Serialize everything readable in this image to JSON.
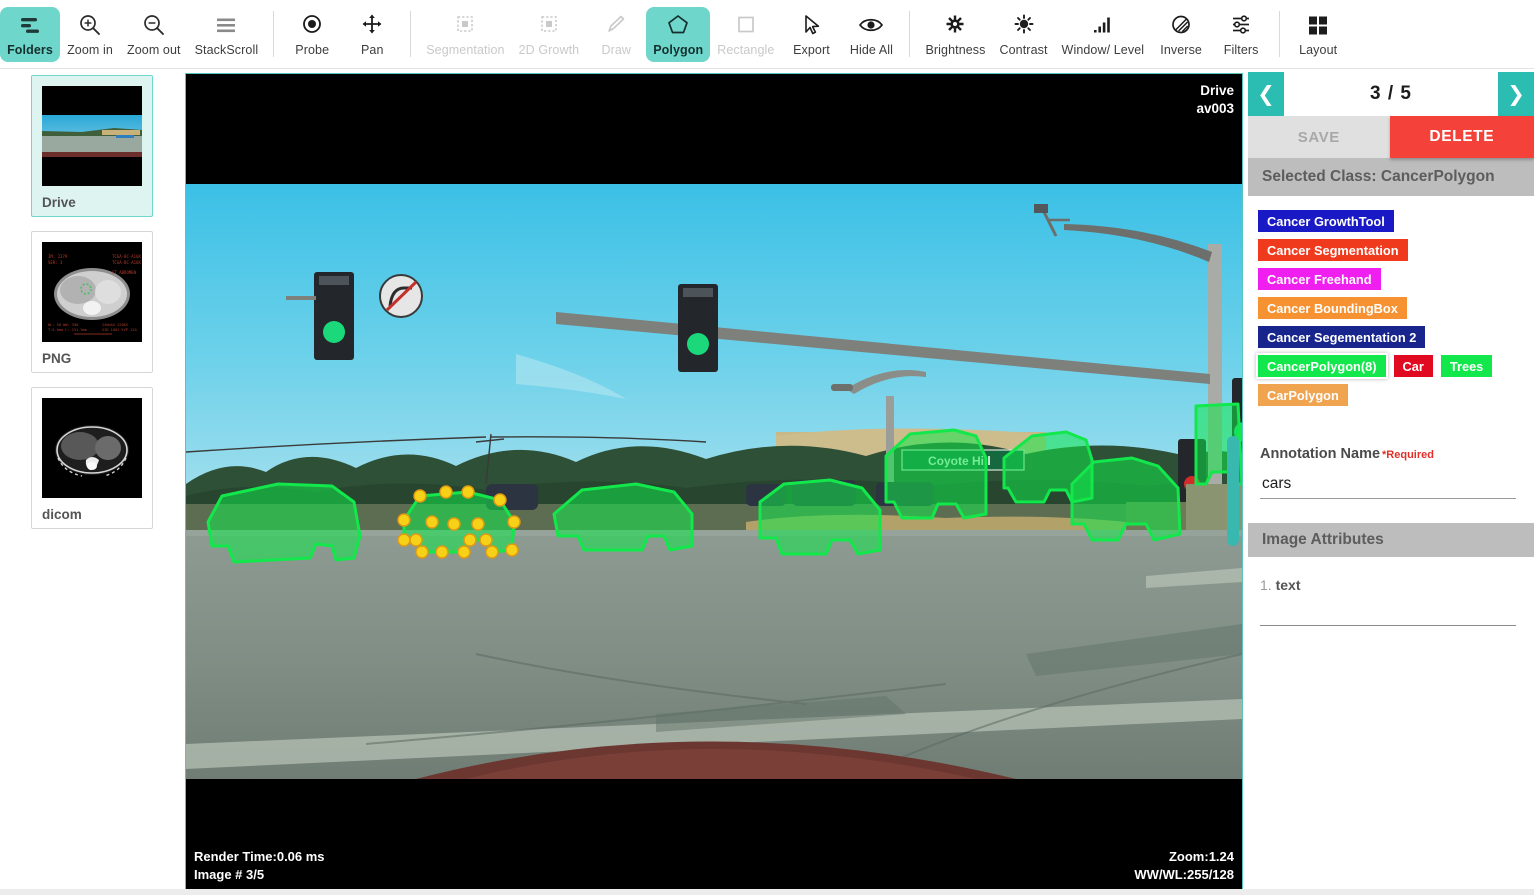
{
  "toolbar": {
    "groups": [
      {
        "tools": [
          {
            "label": "Folders",
            "icon": "folders-icon",
            "state": "active"
          },
          {
            "label": "Zoom in",
            "icon": "zoom-in-icon",
            "state": "normal"
          },
          {
            "label": "Zoom out",
            "icon": "zoom-out-icon",
            "state": "normal"
          },
          {
            "label": "StackScroll",
            "icon": "stack-scroll-icon",
            "state": "normal"
          }
        ]
      },
      {
        "tools": [
          {
            "label": "Probe",
            "icon": "probe-icon",
            "state": "normal"
          },
          {
            "label": "Pan",
            "icon": "pan-icon",
            "state": "normal"
          }
        ]
      },
      {
        "tools": [
          {
            "label": "Segmentation",
            "icon": "segmentation-icon",
            "state": "disabled"
          },
          {
            "label": "2D Growth",
            "icon": "growth-2d-icon",
            "state": "disabled"
          },
          {
            "label": "Draw",
            "icon": "draw-pencil-icon",
            "state": "disabled"
          },
          {
            "label": "Polygon",
            "icon": "polygon-icon",
            "state": "active"
          },
          {
            "label": "Rectangle",
            "icon": "rectangle-icon",
            "state": "disabled"
          },
          {
            "label": "Export",
            "icon": "cursor-arrow-icon",
            "state": "normal"
          },
          {
            "label": "Hide All",
            "icon": "eye-icon",
            "state": "normal"
          }
        ]
      },
      {
        "tools": [
          {
            "label": "Brightness",
            "icon": "brightness-icon",
            "state": "normal"
          },
          {
            "label": "Contrast",
            "icon": "contrast-icon",
            "state": "normal"
          },
          {
            "label": "Window/ Level",
            "icon": "window-level-icon",
            "state": "normal"
          },
          {
            "label": "Inverse",
            "icon": "inverse-drop-icon",
            "state": "normal"
          },
          {
            "label": "Filters",
            "icon": "filters-sliders-icon",
            "state": "normal"
          }
        ]
      },
      {
        "tools": [
          {
            "label": "Layout",
            "icon": "layout-grid-icon",
            "state": "normal"
          }
        ]
      }
    ]
  },
  "sidebar": {
    "folders": [
      {
        "label": "Drive",
        "selected": true
      },
      {
        "label": "PNG",
        "selected": false
      },
      {
        "label": "dicom",
        "selected": false
      }
    ]
  },
  "viewport": {
    "overlay_title": "Drive",
    "overlay_subtitle": "av003",
    "render_time": "Render Time:0.06 ms",
    "image_number": "Image # 3/5",
    "zoom": "Zoom:1.24",
    "window_level": "WW/WL:255/128"
  },
  "rightpanel": {
    "prev_icon": "chevron-left-icon",
    "next_icon": "chevron-right-icon",
    "counter": "3 / 5",
    "save_label": "SAVE",
    "delete_label": "DELETE",
    "selected_class_label": "Selected Class: CancerPolygon",
    "classes": [
      {
        "label": "Cancer GrowthTool",
        "color": "#1919c6",
        "selected": false
      },
      {
        "label": "Cancer Segmentation",
        "color": "#f03a1e",
        "selected": false
      },
      {
        "label": "Cancer Freehand",
        "color": "#ef1fef",
        "selected": false
      },
      {
        "label": "Cancer BoundingBox",
        "color": "#f79233",
        "selected": false
      },
      {
        "label": "Cancer Segementation 2",
        "color": "#17258c",
        "selected": false
      },
      {
        "label": "CancerPolygon(8)",
        "color": "#12e84b",
        "selected": true
      },
      {
        "label": "Car",
        "color": "#e00b20",
        "selected": false
      },
      {
        "label": "Trees",
        "color": "#12e84b",
        "selected": false
      },
      {
        "label": "CarPolygon",
        "color": "#f0a44f",
        "selected": false
      }
    ],
    "annotation_name_label": "Annotation Name",
    "annotation_required": "*Required",
    "annotation_name_value": "cars",
    "annotation_name_placeholder": "",
    "image_attributes_title": "Image Attributes",
    "attributes": [
      {
        "number": "1.",
        "label": "text"
      }
    ]
  },
  "colors": {
    "accent_teal": "#6fd6cb",
    "nav_teal": "#2bbcb2",
    "delete_red": "#f4423a",
    "panel_gray": "#bdbdbd",
    "annotation_green": "#12e84b"
  }
}
